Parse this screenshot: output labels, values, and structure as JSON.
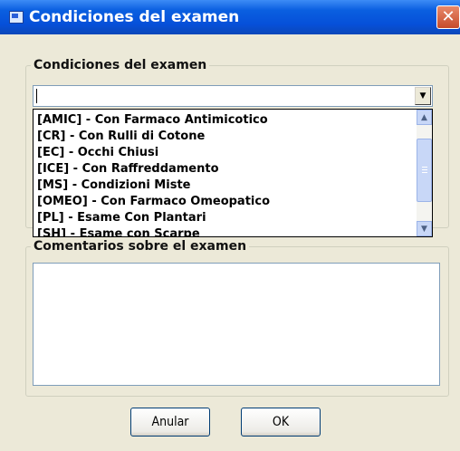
{
  "window": {
    "title": "Condiciones del examen",
    "close_glyph": "✕"
  },
  "conditions_group": {
    "label": "Condiciones del examen",
    "combo_value": "",
    "items": [
      "[AMIC] - Con Farmaco Antimicotico",
      "[CR] - Con Rulli di Cotone",
      "[EC] - Occhi Chiusi",
      "[ICE] - Con Raffreddamento",
      "[MS] - Condizioni Miste",
      "[OMEO] - Con Farmaco Omeopatico",
      "[PL] - Esame Con Plantari",
      "[SH] - Esame con Scarpe"
    ]
  },
  "comments_group": {
    "label": "Comentarios sobre el examen",
    "value": ""
  },
  "buttons": {
    "cancel_label": "Anular",
    "ok_label": "OK"
  },
  "icons": {
    "app": "window-icon",
    "close": "close-icon",
    "dropdown": "chevron-down-icon",
    "scroll_up": "chevron-up-icon",
    "scroll_down": "chevron-down-icon"
  }
}
